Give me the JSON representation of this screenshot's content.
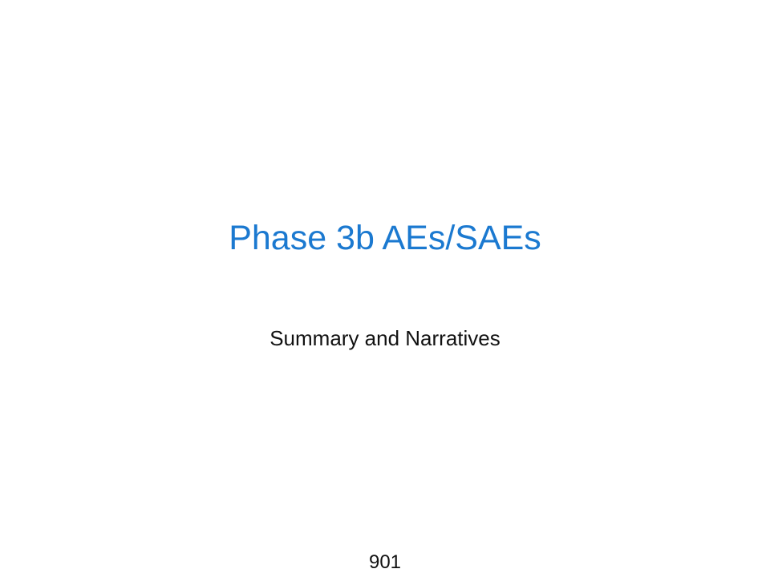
{
  "slide": {
    "title": "Phase 3b AEs/SAEs",
    "subtitle": "Summary and Narratives",
    "page_number": "901"
  },
  "colors": {
    "title": "#1b79d0",
    "body_text": "#111111",
    "background": "#ffffff"
  }
}
